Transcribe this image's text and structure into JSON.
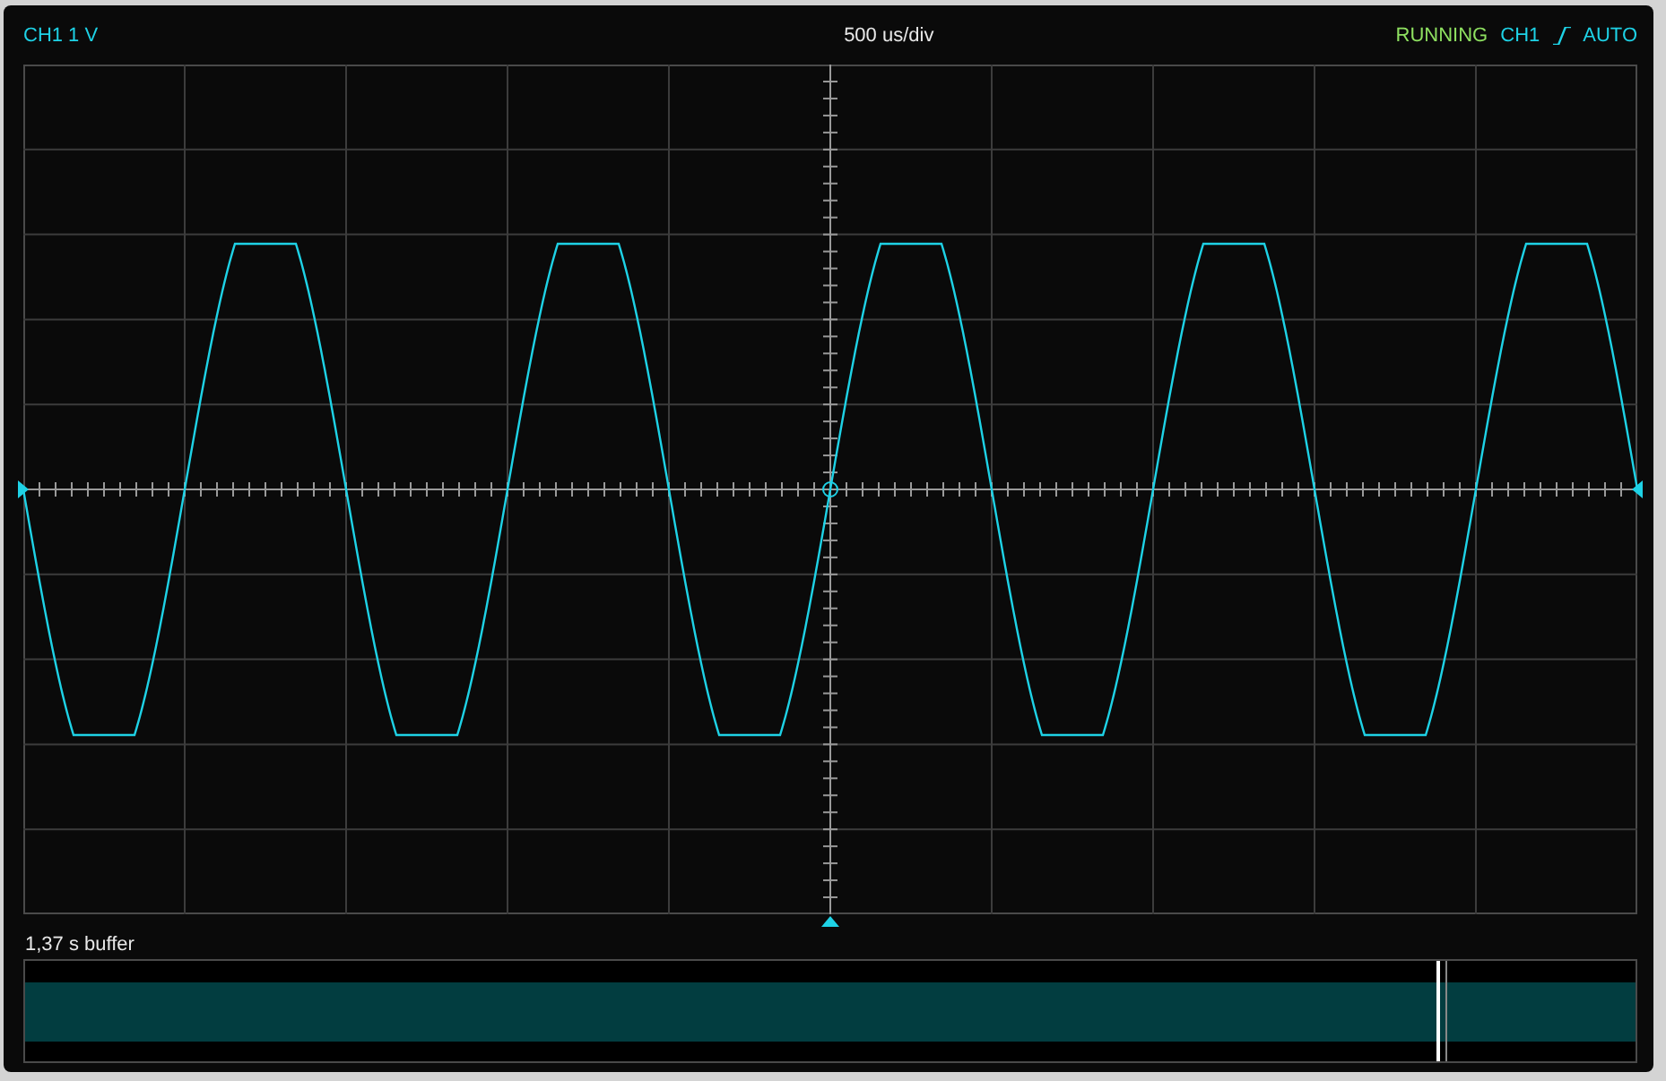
{
  "header": {
    "channel_label": "CH1 1 V",
    "timebase": "500 us/div",
    "status": "RUNNING",
    "trigger_source": "CH1",
    "trigger_mode": "AUTO"
  },
  "buffer": {
    "label": "1,37 s buffer",
    "level": 1
  }
}
